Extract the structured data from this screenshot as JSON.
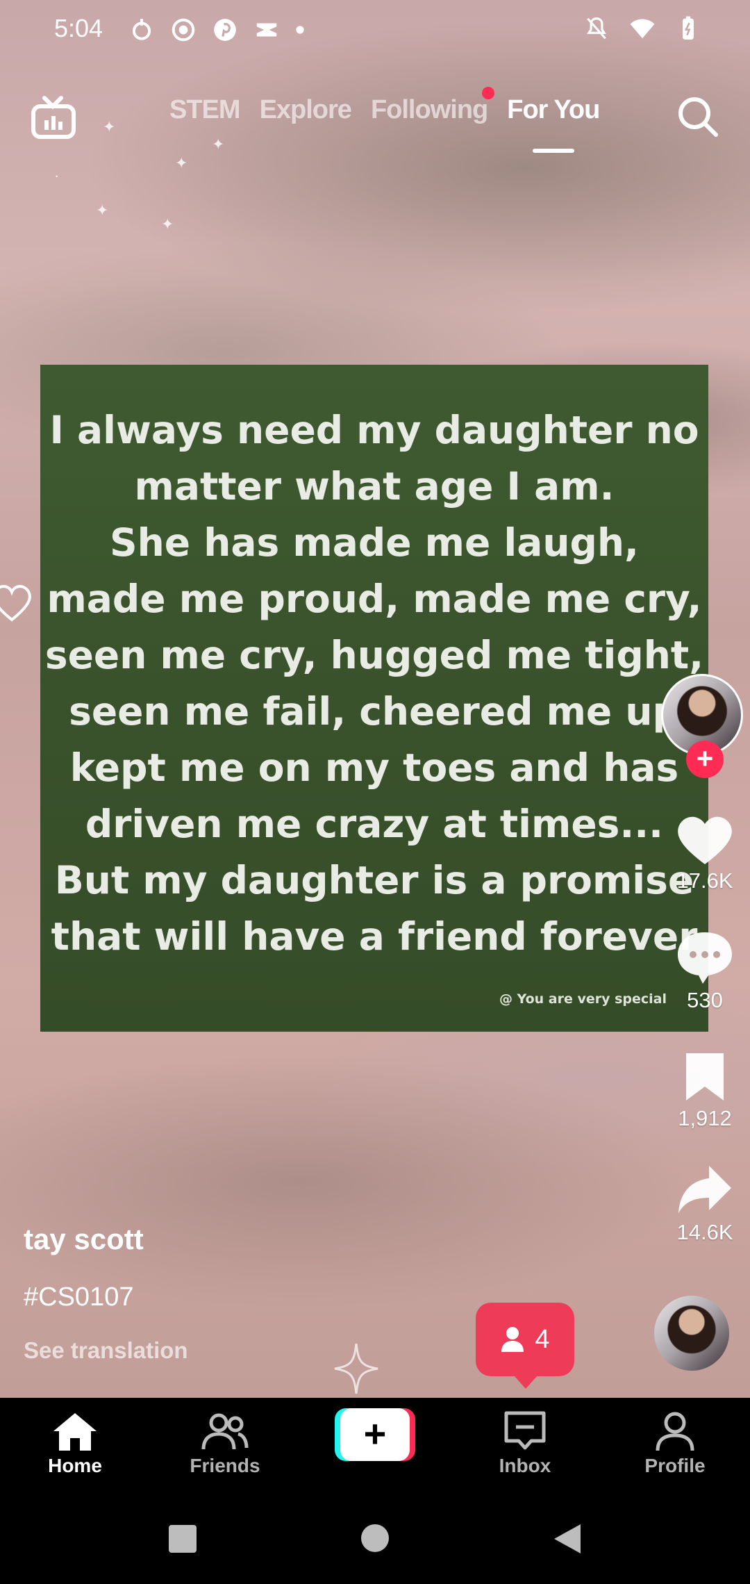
{
  "status_bar": {
    "time": "5:04"
  },
  "top_nav": {
    "tabs": [
      "STEM",
      "Explore",
      "Following",
      "For You"
    ],
    "active_tab": "For You"
  },
  "video": {
    "quote_lines": [
      "I always need my daughter no",
      "matter what age I am.",
      "She has made me laugh,",
      "made me proud, made me cry,",
      "seen me cry, hugged me tight,",
      "seen me fail, cheered me up",
      "kept me on my toes and has",
      "driven me crazy at times...",
      "But my daughter is a promise",
      "that will have a friend forever"
    ],
    "watermark": "@ You are very special"
  },
  "actions": {
    "likes": "17.6K",
    "comments": "530",
    "saves": "1,912",
    "shares": "14.6K"
  },
  "caption": {
    "username": "tay scott",
    "hashtag": "#CS0107",
    "translation": "See translation"
  },
  "friends_popup": {
    "count": "4"
  },
  "bottom_nav": {
    "home": "Home",
    "friends": "Friends",
    "inbox": "Inbox",
    "profile": "Profile"
  },
  "colors": {
    "accent": "#fe2c55",
    "cyan": "#25f4ee",
    "card_green": "#3a522c"
  }
}
